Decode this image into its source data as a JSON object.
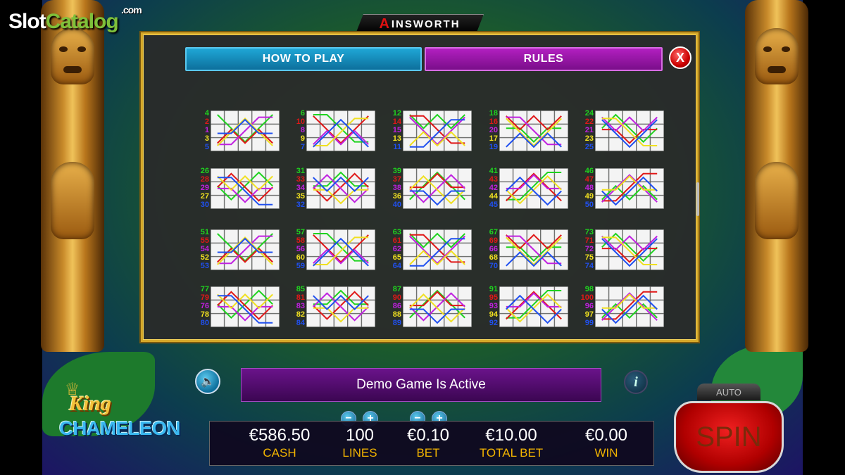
{
  "watermark": {
    "part1": "Slot",
    "part2": "Catalog",
    "suffix": ".com"
  },
  "provider": {
    "name": "INSWORTH",
    "mark": "A"
  },
  "tabs": {
    "how_to_play": "HOW TO PLAY",
    "rules": "RULES"
  },
  "close_label": "X",
  "message": "Demo Game Is Active",
  "info_label": "i",
  "game_logo": {
    "line1": "King",
    "line2": "CHAMELEON"
  },
  "stats": {
    "cash": {
      "value": "€586.50",
      "label": "CASH"
    },
    "lines": {
      "value": "100",
      "label": "LINES"
    },
    "bet": {
      "value": "€0.10",
      "label": "BET"
    },
    "total_bet": {
      "value": "€10.00",
      "label": "TOTAL BET"
    },
    "win": {
      "value": "€0.00",
      "label": "WIN"
    }
  },
  "buttons": {
    "minus": "−",
    "plus": "+",
    "spin": "SPIN",
    "auto": "AUTO"
  },
  "colors": {
    "green": "#1fd31f",
    "red": "#e01818",
    "purple": "#c020e0",
    "yellow": "#f0e020",
    "blue": "#2050f0"
  },
  "paylines": [
    {
      "nums": [
        "4",
        "2",
        "1",
        "3",
        "5"
      ],
      "colors": [
        "green",
        "red",
        "purple",
        "yellow",
        "blue"
      ]
    },
    {
      "nums": [
        "6",
        "10",
        "8",
        "9",
        "7"
      ],
      "colors": [
        "green",
        "red",
        "purple",
        "yellow",
        "blue"
      ]
    },
    {
      "nums": [
        "12",
        "14",
        "15",
        "13",
        "11"
      ],
      "colors": [
        "green",
        "red",
        "purple",
        "yellow",
        "blue"
      ]
    },
    {
      "nums": [
        "18",
        "16",
        "20",
        "17",
        "19"
      ],
      "colors": [
        "green",
        "red",
        "purple",
        "yellow",
        "blue"
      ]
    },
    {
      "nums": [
        "24",
        "22",
        "21",
        "23",
        "25"
      ],
      "colors": [
        "green",
        "red",
        "purple",
        "yellow",
        "blue"
      ]
    },
    {
      "nums": [
        "26",
        "28",
        "29",
        "27",
        "30"
      ],
      "colors": [
        "green",
        "red",
        "purple",
        "yellow",
        "blue"
      ]
    },
    {
      "nums": [
        "31",
        "33",
        "34",
        "35",
        "32"
      ],
      "colors": [
        "green",
        "red",
        "purple",
        "yellow",
        "blue"
      ]
    },
    {
      "nums": [
        "39",
        "37",
        "38",
        "36",
        "40"
      ],
      "colors": [
        "green",
        "red",
        "purple",
        "yellow",
        "blue"
      ]
    },
    {
      "nums": [
        "41",
        "43",
        "42",
        "44",
        "45"
      ],
      "colors": [
        "green",
        "red",
        "purple",
        "yellow",
        "blue"
      ]
    },
    {
      "nums": [
        "46",
        "47",
        "48",
        "49",
        "50"
      ],
      "colors": [
        "green",
        "red",
        "purple",
        "yellow",
        "blue"
      ]
    },
    {
      "nums": [
        "51",
        "55",
        "54",
        "52",
        "53"
      ],
      "colors": [
        "green",
        "red",
        "purple",
        "yellow",
        "blue"
      ]
    },
    {
      "nums": [
        "57",
        "58",
        "56",
        "60",
        "59"
      ],
      "colors": [
        "green",
        "red",
        "purple",
        "yellow",
        "blue"
      ]
    },
    {
      "nums": [
        "63",
        "61",
        "62",
        "65",
        "64"
      ],
      "colors": [
        "green",
        "red",
        "purple",
        "yellow",
        "blue"
      ]
    },
    {
      "nums": [
        "67",
        "69",
        "66",
        "68",
        "70"
      ],
      "colors": [
        "green",
        "red",
        "purple",
        "yellow",
        "blue"
      ]
    },
    {
      "nums": [
        "73",
        "71",
        "72",
        "75",
        "74"
      ],
      "colors": [
        "green",
        "red",
        "purple",
        "yellow",
        "blue"
      ]
    },
    {
      "nums": [
        "77",
        "79",
        "76",
        "78",
        "80"
      ],
      "colors": [
        "green",
        "red",
        "purple",
        "yellow",
        "blue"
      ]
    },
    {
      "nums": [
        "85",
        "81",
        "83",
        "82",
        "84"
      ],
      "colors": [
        "green",
        "red",
        "purple",
        "yellow",
        "blue"
      ]
    },
    {
      "nums": [
        "87",
        "90",
        "86",
        "88",
        "89"
      ],
      "colors": [
        "green",
        "red",
        "purple",
        "yellow",
        "blue"
      ]
    },
    {
      "nums": [
        "91",
        "95",
        "93",
        "94",
        "92"
      ],
      "colors": [
        "green",
        "red",
        "purple",
        "yellow",
        "blue"
      ]
    },
    {
      "nums": [
        "98",
        "100",
        "96",
        "97",
        "99"
      ],
      "colors": [
        "green",
        "red",
        "purple",
        "yellow",
        "blue"
      ]
    }
  ]
}
